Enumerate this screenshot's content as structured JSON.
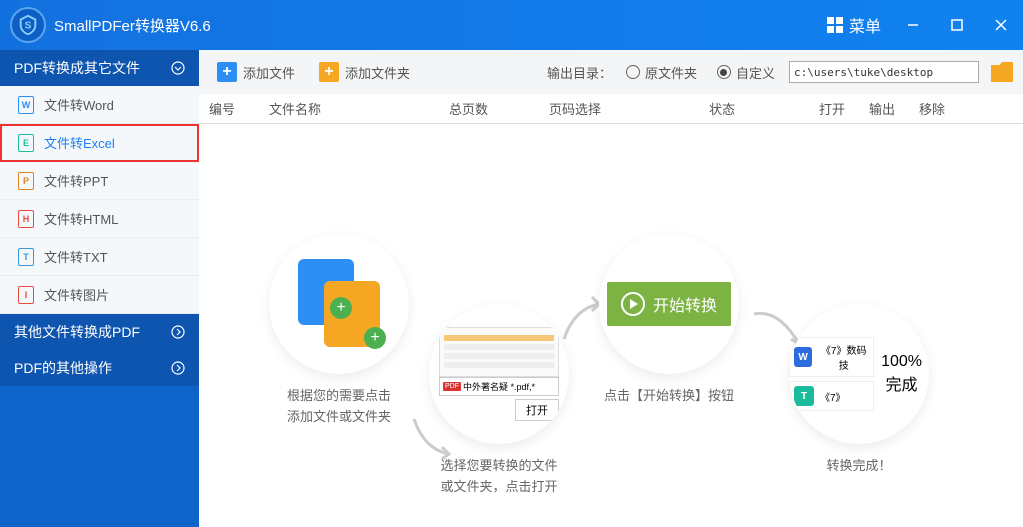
{
  "title": "SmallPDFer转换器V6.6",
  "menu_label": "菜单",
  "sidebar": {
    "cat1": "PDF转换成其它文件",
    "items": [
      {
        "icon": "W",
        "color": "#2d8ef5",
        "label": "文件转Word"
      },
      {
        "icon": "E",
        "color": "#1abc9c",
        "label": "文件转Excel"
      },
      {
        "icon": "P",
        "color": "#e67e22",
        "label": "文件转PPT"
      },
      {
        "icon": "H",
        "color": "#e74c3c",
        "label": "文件转HTML"
      },
      {
        "icon": "T",
        "color": "#3498db",
        "label": "文件转TXT"
      },
      {
        "icon": "I",
        "color": "#e74c3c",
        "label": "文件转图片"
      }
    ],
    "cat2": "其他文件转换成PDF",
    "cat3": "PDF的其他操作"
  },
  "toolbar": {
    "add_file": "添加文件",
    "add_folder": "添加文件夹",
    "output_label": "输出目录：",
    "radio_source": "原文件夹",
    "radio_custom": "自定义",
    "path": "c:\\users\\tuke\\desktop"
  },
  "columns": {
    "c1": "编号",
    "c2": "文件名称",
    "c3": "总页数",
    "c4": "页码选择",
    "c5": "状态",
    "c6": "打开",
    "c7": "输出",
    "c8": "移除"
  },
  "steps": {
    "s1": "根据您的需要点击\n添加文件或文件夹",
    "s2_filename": "中外著名疑 *.pdf,*",
    "s2_open": "打开",
    "s2": "选择您要转换的文件\n或文件夹，点击打开",
    "s3_btn": "开始转换",
    "s3": "点击【开始转换】按钮",
    "s4_r1": "《7》数码技",
    "s4_r2": "《7》",
    "s4_done": "100%  完成",
    "s4": "转换完成！"
  }
}
